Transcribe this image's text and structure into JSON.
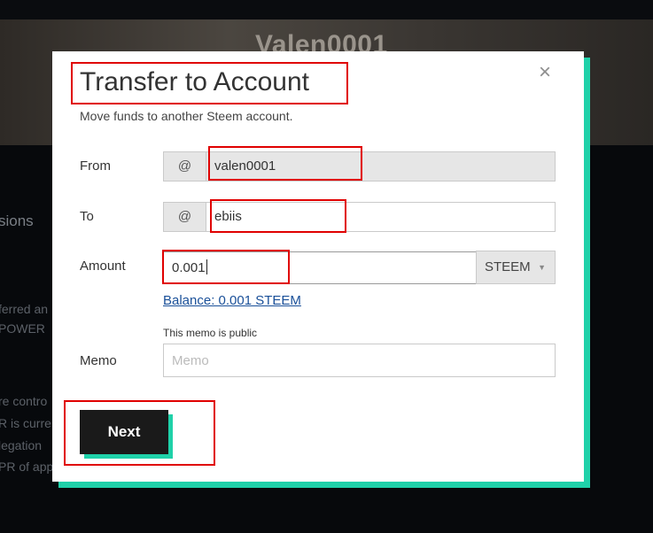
{
  "background": {
    "profile_name": "Valen0001",
    "tab_label": "sions",
    "text_lines": [
      "ferred an",
      "POWER",
      "re contro",
      "R is curre",
      "legation",
      "PR of app"
    ]
  },
  "modal": {
    "title": "Transfer to Account",
    "subtitle": "Move funds to another Steem account.",
    "close_label": "×",
    "from": {
      "label": "From",
      "prefix": "@",
      "value": "valen0001"
    },
    "to": {
      "label": "To",
      "prefix": "@",
      "value": "ebiis"
    },
    "amount": {
      "label": "Amount",
      "value": "0.001",
      "currency": "STEEM",
      "currency_arrow": "▼",
      "balance": "Balance: 0.001 STEEM"
    },
    "memo": {
      "label": "Memo",
      "note": "This memo is public",
      "placeholder": "Memo",
      "value": ""
    },
    "next_label": "Next"
  },
  "colors": {
    "accent": "#1fd1a9",
    "annotation": "#e00000",
    "link": "#1a5099"
  }
}
